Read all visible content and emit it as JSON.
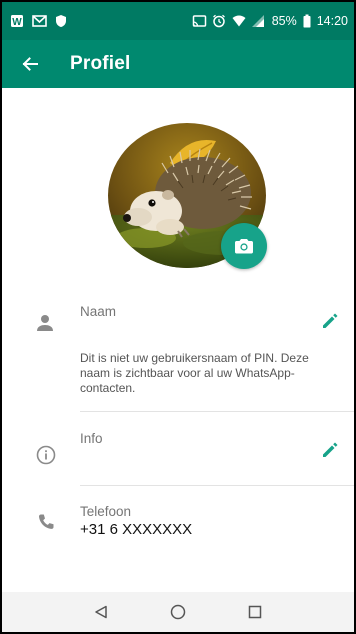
{
  "status_bar": {
    "battery": "85%",
    "time": "14:20"
  },
  "app_bar": {
    "title": "Profiel"
  },
  "profile": {
    "name_label": "Naam",
    "name_help": "Dit is niet uw gebruikersnaam of PIN. Deze naam is zichtbaar voor al uw WhatsApp-contacten.",
    "info_label": "Info",
    "phone_label": "Telefoon",
    "phone_value": "+31 6 XXXXXXX"
  },
  "colors": {
    "status_bar": "#007a63",
    "app_bar": "#00896f",
    "accent": "#17a38a",
    "icon_gray": "#8a8a8a"
  },
  "icons": {
    "back": "arrow-left-icon",
    "camera": "camera-icon",
    "person": "person-icon",
    "info": "info-icon",
    "phone": "phone-icon",
    "edit": "pencil-icon"
  }
}
